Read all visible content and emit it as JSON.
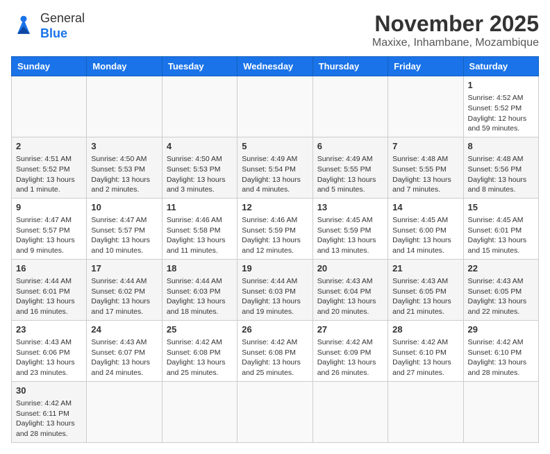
{
  "header": {
    "logo_general": "General",
    "logo_blue": "Blue",
    "month_title": "November 2025",
    "location": "Maxixe, Inhambane, Mozambique"
  },
  "weekdays": [
    "Sunday",
    "Monday",
    "Tuesday",
    "Wednesday",
    "Thursday",
    "Friday",
    "Saturday"
  ],
  "weeks": [
    [
      {
        "day": "",
        "info": ""
      },
      {
        "day": "",
        "info": ""
      },
      {
        "day": "",
        "info": ""
      },
      {
        "day": "",
        "info": ""
      },
      {
        "day": "",
        "info": ""
      },
      {
        "day": "",
        "info": ""
      },
      {
        "day": "1",
        "info": "Sunrise: 4:52 AM\nSunset: 5:52 PM\nDaylight: 12 hours and 59 minutes."
      }
    ],
    [
      {
        "day": "2",
        "info": "Sunrise: 4:51 AM\nSunset: 5:52 PM\nDaylight: 13 hours and 1 minute."
      },
      {
        "day": "3",
        "info": "Sunrise: 4:50 AM\nSunset: 5:53 PM\nDaylight: 13 hours and 2 minutes."
      },
      {
        "day": "4",
        "info": "Sunrise: 4:50 AM\nSunset: 5:53 PM\nDaylight: 13 hours and 3 minutes."
      },
      {
        "day": "5",
        "info": "Sunrise: 4:49 AM\nSunset: 5:54 PM\nDaylight: 13 hours and 4 minutes."
      },
      {
        "day": "6",
        "info": "Sunrise: 4:49 AM\nSunset: 5:55 PM\nDaylight: 13 hours and 5 minutes."
      },
      {
        "day": "7",
        "info": "Sunrise: 4:48 AM\nSunset: 5:55 PM\nDaylight: 13 hours and 7 minutes."
      },
      {
        "day": "8",
        "info": "Sunrise: 4:48 AM\nSunset: 5:56 PM\nDaylight: 13 hours and 8 minutes."
      }
    ],
    [
      {
        "day": "9",
        "info": "Sunrise: 4:47 AM\nSunset: 5:57 PM\nDaylight: 13 hours and 9 minutes."
      },
      {
        "day": "10",
        "info": "Sunrise: 4:47 AM\nSunset: 5:57 PM\nDaylight: 13 hours and 10 minutes."
      },
      {
        "day": "11",
        "info": "Sunrise: 4:46 AM\nSunset: 5:58 PM\nDaylight: 13 hours and 11 minutes."
      },
      {
        "day": "12",
        "info": "Sunrise: 4:46 AM\nSunset: 5:59 PM\nDaylight: 13 hours and 12 minutes."
      },
      {
        "day": "13",
        "info": "Sunrise: 4:45 AM\nSunset: 5:59 PM\nDaylight: 13 hours and 13 minutes."
      },
      {
        "day": "14",
        "info": "Sunrise: 4:45 AM\nSunset: 6:00 PM\nDaylight: 13 hours and 14 minutes."
      },
      {
        "day": "15",
        "info": "Sunrise: 4:45 AM\nSunset: 6:01 PM\nDaylight: 13 hours and 15 minutes."
      }
    ],
    [
      {
        "day": "16",
        "info": "Sunrise: 4:44 AM\nSunset: 6:01 PM\nDaylight: 13 hours and 16 minutes."
      },
      {
        "day": "17",
        "info": "Sunrise: 4:44 AM\nSunset: 6:02 PM\nDaylight: 13 hours and 17 minutes."
      },
      {
        "day": "18",
        "info": "Sunrise: 4:44 AM\nSunset: 6:03 PM\nDaylight: 13 hours and 18 minutes."
      },
      {
        "day": "19",
        "info": "Sunrise: 4:44 AM\nSunset: 6:03 PM\nDaylight: 13 hours and 19 minutes."
      },
      {
        "day": "20",
        "info": "Sunrise: 4:43 AM\nSunset: 6:04 PM\nDaylight: 13 hours and 20 minutes."
      },
      {
        "day": "21",
        "info": "Sunrise: 4:43 AM\nSunset: 6:05 PM\nDaylight: 13 hours and 21 minutes."
      },
      {
        "day": "22",
        "info": "Sunrise: 4:43 AM\nSunset: 6:05 PM\nDaylight: 13 hours and 22 minutes."
      }
    ],
    [
      {
        "day": "23",
        "info": "Sunrise: 4:43 AM\nSunset: 6:06 PM\nDaylight: 13 hours and 23 minutes."
      },
      {
        "day": "24",
        "info": "Sunrise: 4:43 AM\nSunset: 6:07 PM\nDaylight: 13 hours and 24 minutes."
      },
      {
        "day": "25",
        "info": "Sunrise: 4:42 AM\nSunset: 6:08 PM\nDaylight: 13 hours and 25 minutes."
      },
      {
        "day": "26",
        "info": "Sunrise: 4:42 AM\nSunset: 6:08 PM\nDaylight: 13 hours and 25 minutes."
      },
      {
        "day": "27",
        "info": "Sunrise: 4:42 AM\nSunset: 6:09 PM\nDaylight: 13 hours and 26 minutes."
      },
      {
        "day": "28",
        "info": "Sunrise: 4:42 AM\nSunset: 6:10 PM\nDaylight: 13 hours and 27 minutes."
      },
      {
        "day": "29",
        "info": "Sunrise: 4:42 AM\nSunset: 6:10 PM\nDaylight: 13 hours and 28 minutes."
      }
    ],
    [
      {
        "day": "30",
        "info": "Sunrise: 4:42 AM\nSunset: 6:11 PM\nDaylight: 13 hours and 28 minutes."
      },
      {
        "day": "",
        "info": ""
      },
      {
        "day": "",
        "info": ""
      },
      {
        "day": "",
        "info": ""
      },
      {
        "day": "",
        "info": ""
      },
      {
        "day": "",
        "info": ""
      },
      {
        "day": "",
        "info": ""
      }
    ]
  ]
}
